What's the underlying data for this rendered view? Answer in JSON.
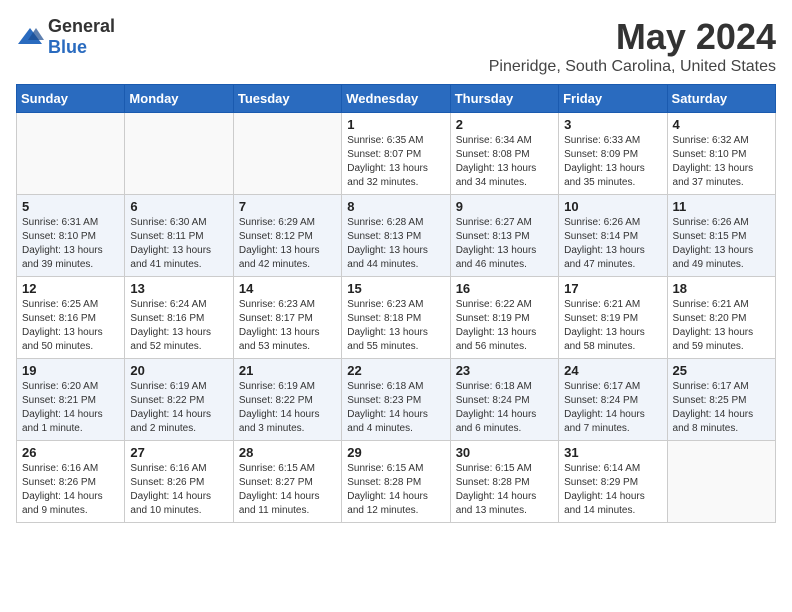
{
  "logo": {
    "text_general": "General",
    "text_blue": "Blue"
  },
  "header": {
    "month_year": "May 2024",
    "location": "Pineridge, South Carolina, United States"
  },
  "weekdays": [
    "Sunday",
    "Monday",
    "Tuesday",
    "Wednesday",
    "Thursday",
    "Friday",
    "Saturday"
  ],
  "weeks": [
    [
      {
        "day": "",
        "info": ""
      },
      {
        "day": "",
        "info": ""
      },
      {
        "day": "",
        "info": ""
      },
      {
        "day": "1",
        "info": "Sunrise: 6:35 AM\nSunset: 8:07 PM\nDaylight: 13 hours and 32 minutes."
      },
      {
        "day": "2",
        "info": "Sunrise: 6:34 AM\nSunset: 8:08 PM\nDaylight: 13 hours and 34 minutes."
      },
      {
        "day": "3",
        "info": "Sunrise: 6:33 AM\nSunset: 8:09 PM\nDaylight: 13 hours and 35 minutes."
      },
      {
        "day": "4",
        "info": "Sunrise: 6:32 AM\nSunset: 8:10 PM\nDaylight: 13 hours and 37 minutes."
      }
    ],
    [
      {
        "day": "5",
        "info": "Sunrise: 6:31 AM\nSunset: 8:10 PM\nDaylight: 13 hours and 39 minutes."
      },
      {
        "day": "6",
        "info": "Sunrise: 6:30 AM\nSunset: 8:11 PM\nDaylight: 13 hours and 41 minutes."
      },
      {
        "day": "7",
        "info": "Sunrise: 6:29 AM\nSunset: 8:12 PM\nDaylight: 13 hours and 42 minutes."
      },
      {
        "day": "8",
        "info": "Sunrise: 6:28 AM\nSunset: 8:13 PM\nDaylight: 13 hours and 44 minutes."
      },
      {
        "day": "9",
        "info": "Sunrise: 6:27 AM\nSunset: 8:13 PM\nDaylight: 13 hours and 46 minutes."
      },
      {
        "day": "10",
        "info": "Sunrise: 6:26 AM\nSunset: 8:14 PM\nDaylight: 13 hours and 47 minutes."
      },
      {
        "day": "11",
        "info": "Sunrise: 6:26 AM\nSunset: 8:15 PM\nDaylight: 13 hours and 49 minutes."
      }
    ],
    [
      {
        "day": "12",
        "info": "Sunrise: 6:25 AM\nSunset: 8:16 PM\nDaylight: 13 hours and 50 minutes."
      },
      {
        "day": "13",
        "info": "Sunrise: 6:24 AM\nSunset: 8:16 PM\nDaylight: 13 hours and 52 minutes."
      },
      {
        "day": "14",
        "info": "Sunrise: 6:23 AM\nSunset: 8:17 PM\nDaylight: 13 hours and 53 minutes."
      },
      {
        "day": "15",
        "info": "Sunrise: 6:23 AM\nSunset: 8:18 PM\nDaylight: 13 hours and 55 minutes."
      },
      {
        "day": "16",
        "info": "Sunrise: 6:22 AM\nSunset: 8:19 PM\nDaylight: 13 hours and 56 minutes."
      },
      {
        "day": "17",
        "info": "Sunrise: 6:21 AM\nSunset: 8:19 PM\nDaylight: 13 hours and 58 minutes."
      },
      {
        "day": "18",
        "info": "Sunrise: 6:21 AM\nSunset: 8:20 PM\nDaylight: 13 hours and 59 minutes."
      }
    ],
    [
      {
        "day": "19",
        "info": "Sunrise: 6:20 AM\nSunset: 8:21 PM\nDaylight: 14 hours and 1 minute."
      },
      {
        "day": "20",
        "info": "Sunrise: 6:19 AM\nSunset: 8:22 PM\nDaylight: 14 hours and 2 minutes."
      },
      {
        "day": "21",
        "info": "Sunrise: 6:19 AM\nSunset: 8:22 PM\nDaylight: 14 hours and 3 minutes."
      },
      {
        "day": "22",
        "info": "Sunrise: 6:18 AM\nSunset: 8:23 PM\nDaylight: 14 hours and 4 minutes."
      },
      {
        "day": "23",
        "info": "Sunrise: 6:18 AM\nSunset: 8:24 PM\nDaylight: 14 hours and 6 minutes."
      },
      {
        "day": "24",
        "info": "Sunrise: 6:17 AM\nSunset: 8:24 PM\nDaylight: 14 hours and 7 minutes."
      },
      {
        "day": "25",
        "info": "Sunrise: 6:17 AM\nSunset: 8:25 PM\nDaylight: 14 hours and 8 minutes."
      }
    ],
    [
      {
        "day": "26",
        "info": "Sunrise: 6:16 AM\nSunset: 8:26 PM\nDaylight: 14 hours and 9 minutes."
      },
      {
        "day": "27",
        "info": "Sunrise: 6:16 AM\nSunset: 8:26 PM\nDaylight: 14 hours and 10 minutes."
      },
      {
        "day": "28",
        "info": "Sunrise: 6:15 AM\nSunset: 8:27 PM\nDaylight: 14 hours and 11 minutes."
      },
      {
        "day": "29",
        "info": "Sunrise: 6:15 AM\nSunset: 8:28 PM\nDaylight: 14 hours and 12 minutes."
      },
      {
        "day": "30",
        "info": "Sunrise: 6:15 AM\nSunset: 8:28 PM\nDaylight: 14 hours and 13 minutes."
      },
      {
        "day": "31",
        "info": "Sunrise: 6:14 AM\nSunset: 8:29 PM\nDaylight: 14 hours and 14 minutes."
      },
      {
        "day": "",
        "info": ""
      }
    ]
  ]
}
